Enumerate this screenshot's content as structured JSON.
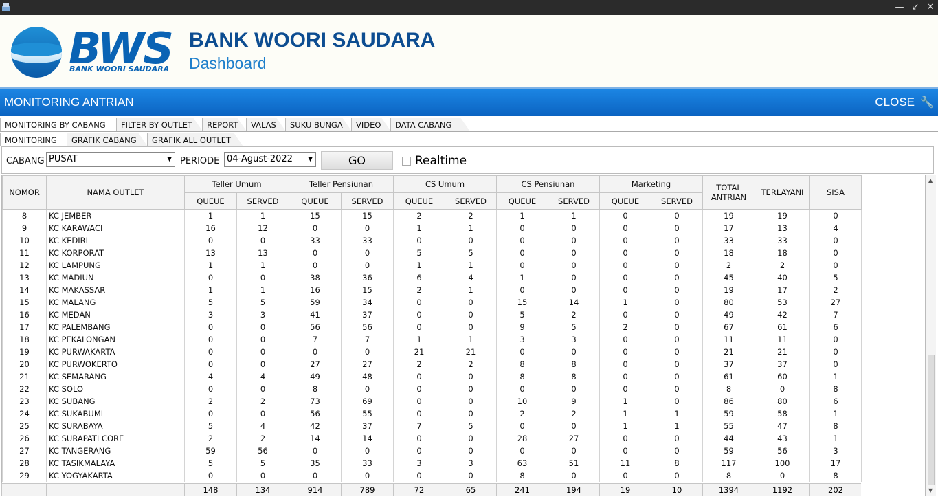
{
  "window": {
    "minimize_icon": "minimize-icon",
    "restore_icon": "restore-icon",
    "close_icon": "close-icon"
  },
  "header": {
    "logo_text": "BWS",
    "logo_subtext": "BANK WOORI SAUDARA",
    "bank_name": "BANK WOORI SAUDARA",
    "subtitle": "Dashboard",
    "brand_color": "#0a63b4"
  },
  "titlebar": {
    "title": "MONITORING ANTRIAN",
    "close_label": "CLOSE",
    "tool_icon": "wrench-icon"
  },
  "tabs": [
    "MONITORING BY CABANG",
    "FILTER BY OUTLET",
    "REPORT",
    "VALAS",
    "SUKU BUNGA",
    "VIDEO",
    "DATA CABANG"
  ],
  "subtabs": [
    "MONITORING",
    "GRAFIK CABANG",
    "GRAFIK ALL OUTLET"
  ],
  "filter": {
    "cabang_label": "CABANG",
    "cabang_value": "PUSAT",
    "periode_label": "PERIODE",
    "periode_value": "04-Agust-2022",
    "go_label": "GO",
    "realtime_label": "Realtime",
    "realtime_checked": false
  },
  "table": {
    "col_nomor": "NOMOR",
    "col_nama": "NAMA OUTLET",
    "groups": [
      "Teller Umum",
      "Teller Pensiunan",
      "CS Umum",
      "CS Pensiunan",
      "Marketing"
    ],
    "sub_queue": "QUEUE",
    "sub_served": "SERVED",
    "col_total": "TOTAL ANTRIAN",
    "col_terlayani": "TERLAYANI",
    "col_sisa": "SISA",
    "rows": [
      [
        "8",
        "KC JEMBER",
        "1",
        "1",
        "15",
        "15",
        "2",
        "2",
        "1",
        "1",
        "0",
        "0",
        "19",
        "19",
        "0"
      ],
      [
        "9",
        "KC KARAWACI",
        "16",
        "12",
        "0",
        "0",
        "1",
        "1",
        "0",
        "0",
        "0",
        "0",
        "17",
        "13",
        "4"
      ],
      [
        "10",
        "KC KEDIRI",
        "0",
        "0",
        "33",
        "33",
        "0",
        "0",
        "0",
        "0",
        "0",
        "0",
        "33",
        "33",
        "0"
      ],
      [
        "11",
        "KC KORPORAT",
        "13",
        "13",
        "0",
        "0",
        "5",
        "5",
        "0",
        "0",
        "0",
        "0",
        "18",
        "18",
        "0"
      ],
      [
        "12",
        "KC LAMPUNG",
        "1",
        "1",
        "0",
        "0",
        "1",
        "1",
        "0",
        "0",
        "0",
        "0",
        "2",
        "2",
        "0"
      ],
      [
        "13",
        "KC MADIUN",
        "0",
        "0",
        "38",
        "36",
        "6",
        "4",
        "1",
        "0",
        "0",
        "0",
        "45",
        "40",
        "5"
      ],
      [
        "14",
        "KC MAKASSAR",
        "1",
        "1",
        "16",
        "15",
        "2",
        "1",
        "0",
        "0",
        "0",
        "0",
        "19",
        "17",
        "2"
      ],
      [
        "15",
        "KC MALANG",
        "5",
        "5",
        "59",
        "34",
        "0",
        "0",
        "15",
        "14",
        "1",
        "0",
        "80",
        "53",
        "27"
      ],
      [
        "16",
        "KC MEDAN",
        "3",
        "3",
        "41",
        "37",
        "0",
        "0",
        "5",
        "2",
        "0",
        "0",
        "49",
        "42",
        "7"
      ],
      [
        "17",
        "KC PALEMBANG",
        "0",
        "0",
        "56",
        "56",
        "0",
        "0",
        "9",
        "5",
        "2",
        "0",
        "67",
        "61",
        "6"
      ],
      [
        "18",
        "KC PEKALONGAN",
        "0",
        "0",
        "7",
        "7",
        "1",
        "1",
        "3",
        "3",
        "0",
        "0",
        "11",
        "11",
        "0"
      ],
      [
        "19",
        "KC PURWAKARTA",
        "0",
        "0",
        "0",
        "0",
        "21",
        "21",
        "0",
        "0",
        "0",
        "0",
        "21",
        "21",
        "0"
      ],
      [
        "20",
        "KC PURWOKERTO",
        "0",
        "0",
        "27",
        "27",
        "2",
        "2",
        "8",
        "8",
        "0",
        "0",
        "37",
        "37",
        "0"
      ],
      [
        "21",
        "KC SEMARANG",
        "4",
        "4",
        "49",
        "48",
        "0",
        "0",
        "8",
        "8",
        "0",
        "0",
        "61",
        "60",
        "1"
      ],
      [
        "22",
        "KC SOLO",
        "0",
        "0",
        "8",
        "0",
        "0",
        "0",
        "0",
        "0",
        "0",
        "0",
        "8",
        "0",
        "8"
      ],
      [
        "23",
        "KC SUBANG",
        "2",
        "2",
        "73",
        "69",
        "0",
        "0",
        "10",
        "9",
        "1",
        "0",
        "86",
        "80",
        "6"
      ],
      [
        "24",
        "KC SUKABUMI",
        "0",
        "0",
        "56",
        "55",
        "0",
        "0",
        "2",
        "2",
        "1",
        "1",
        "59",
        "58",
        "1"
      ],
      [
        "25",
        "KC SURABAYA",
        "5",
        "4",
        "42",
        "37",
        "7",
        "5",
        "0",
        "0",
        "1",
        "1",
        "55",
        "47",
        "8"
      ],
      [
        "26",
        "KC SURAPATI CORE",
        "2",
        "2",
        "14",
        "14",
        "0",
        "0",
        "28",
        "27",
        "0",
        "0",
        "44",
        "43",
        "1"
      ],
      [
        "27",
        "KC TANGERANG",
        "59",
        "56",
        "0",
        "0",
        "0",
        "0",
        "0",
        "0",
        "0",
        "0",
        "59",
        "56",
        "3"
      ],
      [
        "28",
        "KC TASIKMALAYA",
        "5",
        "5",
        "35",
        "33",
        "3",
        "3",
        "63",
        "51",
        "11",
        "8",
        "117",
        "100",
        "17"
      ],
      [
        "29",
        "KC YOGYAKARTA",
        "0",
        "0",
        "0",
        "0",
        "0",
        "0",
        "8",
        "0",
        "0",
        "0",
        "8",
        "0",
        "8"
      ]
    ],
    "totals": [
      "",
      "",
      "148",
      "134",
      "914",
      "789",
      "72",
      "65",
      "241",
      "194",
      "19",
      "10",
      "1394",
      "1192",
      "202"
    ]
  }
}
